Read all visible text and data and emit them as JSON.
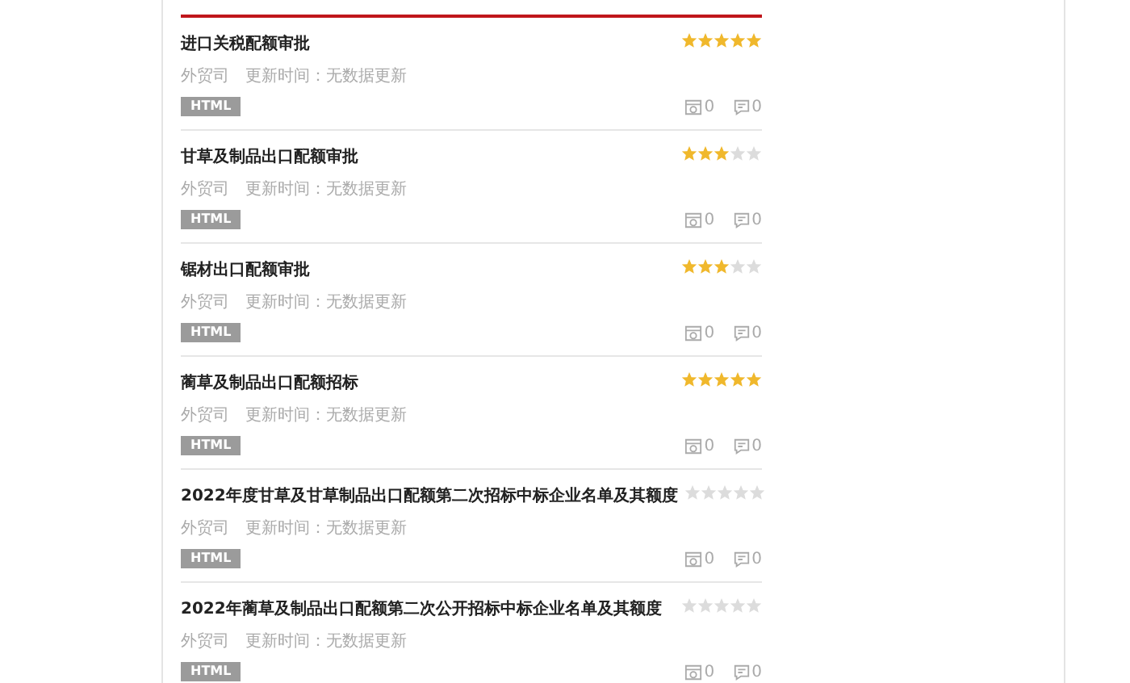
{
  "items": [
    {
      "title": "进口关税配额审批",
      "department": "外贸司",
      "updated": "更新时间：无数据更新",
      "format": "HTML",
      "stars": 5,
      "views": "0",
      "comments": "0"
    },
    {
      "title": "甘草及制品出口配额审批",
      "department": "外贸司",
      "updated": "更新时间：无数据更新",
      "format": "HTML",
      "stars": 3,
      "views": "0",
      "comments": "0"
    },
    {
      "title": "锯材出口配额审批",
      "department": "外贸司",
      "updated": "更新时间：无数据更新",
      "format": "HTML",
      "stars": 3,
      "views": "0",
      "comments": "0"
    },
    {
      "title": "蔺草及制品出口配额招标",
      "department": "外贸司",
      "updated": "更新时间：无数据更新",
      "format": "HTML",
      "stars": 5,
      "views": "0",
      "comments": "0"
    },
    {
      "title": "2022年度甘草及甘草制品出口配额第二次招标中标企业名单及其额度",
      "department": "外贸司",
      "updated": "更新时间：无数据更新",
      "format": "HTML",
      "stars": 0,
      "views": "0",
      "comments": "0"
    },
    {
      "title": "2022年蔺草及制品出口配额第二次公开招标中标企业名单及其额度",
      "department": "外贸司",
      "updated": "更新时间：无数据更新",
      "format": "HTML",
      "stars": 0,
      "views": "0",
      "comments": "0"
    }
  ]
}
